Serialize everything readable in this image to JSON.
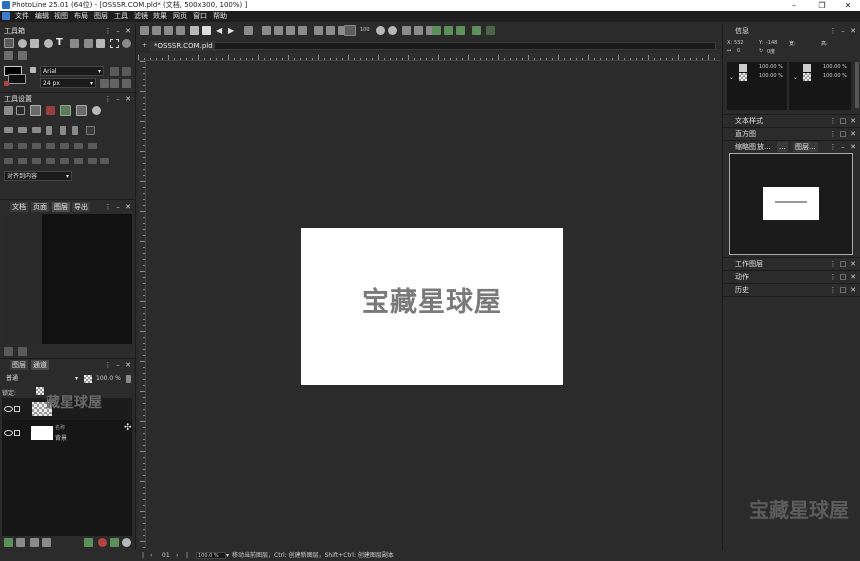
{
  "window": {
    "title": "PhotoLine 25.01 (64位) - [OSSSR.COM.pld* (文档, 500x300, 100%) ]",
    "controls": [
      "–",
      "❐",
      "✕"
    ]
  },
  "menu": [
    "文件",
    "编辑",
    "视图",
    "布局",
    "图层",
    "工具",
    "滤镜",
    "效果",
    "网页",
    "窗口",
    "帮助"
  ],
  "toolbox": {
    "title": "工具箱",
    "font_name": "Arial",
    "font_size": "24 px"
  },
  "tool_settings": {
    "title": "工具设置",
    "align_option": "对齐到内容"
  },
  "doc_panel": {
    "tabs": [
      "文档",
      "页面",
      "图层",
      "导出"
    ]
  },
  "layers_panel": {
    "tabs": [
      "图层",
      "通道"
    ],
    "blend_mode": "普通",
    "opacity": "100.0 %",
    "lock_label": "锁定:",
    "layer2": {
      "name_label": "名称",
      "name": "背景"
    }
  },
  "document": {
    "tab_label": "*OSSSR.COM.pld",
    "canvas_text": "宝藏星球屋"
  },
  "info_panel": {
    "title": "信息",
    "x_label": "X:",
    "x_value": "532",
    "y_label": "Y:",
    "y_value": "-148",
    "w_label": "宽:",
    "h_label": "高:",
    "angle": "0",
    "angle2": "0度",
    "left_vals": [
      "100.00 %",
      "100.00 %"
    ],
    "right_vals": [
      "100.00 %",
      "100.00 %"
    ]
  },
  "right_panels": {
    "text_style": "文本样式",
    "histogram": "直方图",
    "thumbnail_tabs": [
      "缩略图",
      "放...",
      "...",
      "图层..."
    ],
    "work_layers": "工作图层",
    "actions": "动作",
    "history": "历史"
  },
  "statusbar": {
    "page": "01",
    "zoom": "100.0 %",
    "hint": "移动当前图层，Ctrl: 创建新图层，Shift+Ctrl: 创建图层副本"
  },
  "watermarks": {
    "layer_wm": "藏星球屋",
    "corner_wm": "宝藏星球屋"
  },
  "colors": {
    "bg": "#2b2b2b",
    "panel_dark": "#161616",
    "canvas": "#ffffff"
  }
}
